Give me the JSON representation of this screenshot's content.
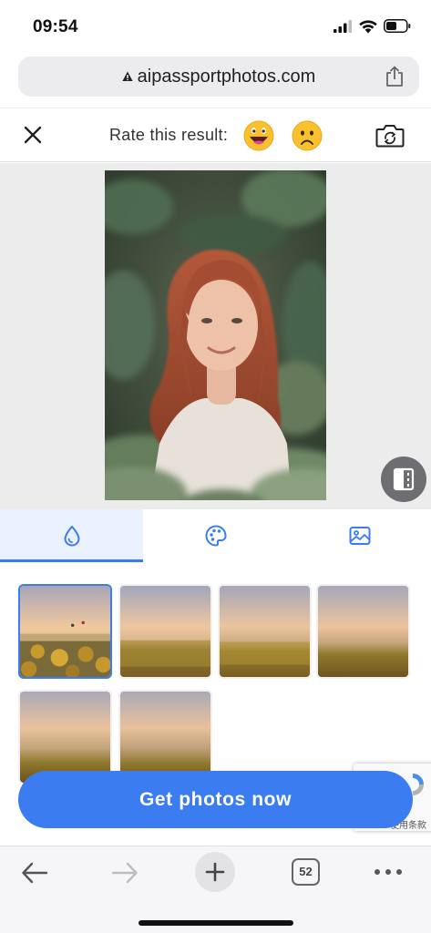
{
  "status_bar": {
    "time": "09:54",
    "signal_icon": "cellular-signal-icon",
    "wifi_icon": "wifi-icon",
    "battery_icon": "battery-icon"
  },
  "browser": {
    "url": "aipassportphotos.com",
    "lock_icon": "warning-lock-icon",
    "share_icon": "share-icon",
    "tabs_count": "52"
  },
  "toolbar": {
    "rate_label": "Rate this result:",
    "close_icon": "close-icon",
    "happy_icon": "happy-emoji-icon",
    "sad_icon": "sad-emoji-icon",
    "rotate_icon": "camera-rotate-icon"
  },
  "tabs": [
    {
      "icon": "drop-icon",
      "active": true
    },
    {
      "icon": "palette-icon",
      "active": false
    },
    {
      "icon": "image-icon",
      "active": false
    }
  ],
  "backgrounds": {
    "selected_index": 0,
    "count": 6
  },
  "cta": {
    "label": "Get photos now"
  },
  "recaptcha": {
    "text": "使用条款"
  },
  "colors": {
    "accent": "#3b7cf0",
    "tab_active_bg": "#eaf1fe",
    "preview_bg": "#ececec"
  }
}
